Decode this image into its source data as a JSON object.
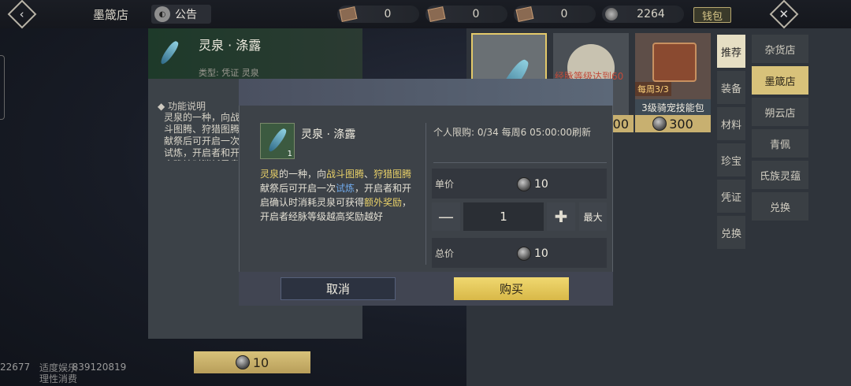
{
  "header": {
    "shop_title": "墨箴店",
    "notice_label": "公告",
    "currencies": [
      {
        "icon": "ticket-icon",
        "value": "0"
      },
      {
        "icon": "ticket-icon",
        "value": "0"
      },
      {
        "icon": "ticket-icon",
        "value": "0"
      },
      {
        "icon": "coin-icon",
        "value": "2264"
      }
    ],
    "wallet_label": "钱包"
  },
  "left_panel": {
    "item_name": "灵泉 · 涤露",
    "item_type": "类型: 凭证 灵泉",
    "desc_title": "功能说明",
    "desc_text": "灵泉的一种，向战斗图腾、狩猎图腾献祭后可开启一次试炼，开启者和开启确认时消耗灵泉可获得额外奖励，开启者经脉等级越高奖励越好",
    "price": "10"
  },
  "shop_cards": [
    {
      "label": "",
      "price": "",
      "tag": ""
    },
    {
      "label": "",
      "price": "300",
      "warn": "经脉等级达到60"
    },
    {
      "label": "3级骑宠技能包",
      "price": "300",
      "tag": "每周3/3"
    }
  ],
  "category_tabs": [
    "推荐",
    "装备",
    "材料",
    "珍宝",
    "凭证",
    "兑换"
  ],
  "shop_tabs": [
    "杂货店",
    "墨箴店",
    "朔云店",
    "青佩",
    "氏族灵蕴",
    "兑换"
  ],
  "dialog": {
    "item_name": "灵泉 · 涤露",
    "item_count": "1",
    "limit_text": "个人限购: 0/34 每周6 05:00:00刷新",
    "desc": {
      "p1": "灵泉",
      "p2": "的一种，向",
      "p3": "战斗图腾",
      "p4": "、",
      "p5": "狩猎图腾",
      "p6": "献祭后可开启一次",
      "p7": "试炼",
      "p8": "，开启者和开启确认时消耗灵泉可获得",
      "p9": "额外奖励",
      "p10": "，开启者经脉等级越高奖励越好"
    },
    "unit_price_label": "单价",
    "unit_price": "10",
    "quantity": "1",
    "max_label": "最大",
    "total_label": "总价",
    "total_price": "10",
    "cancel_label": "取消",
    "buy_label": "购买"
  },
  "footer": {
    "line1": "适度娱乐",
    "line2": "理性消费",
    "uid": "22677              839120819"
  },
  "colors": {
    "accent_gold": "#d8c27a",
    "highlight_yellow": "#e8d068",
    "link_blue": "#6fa8e8"
  }
}
